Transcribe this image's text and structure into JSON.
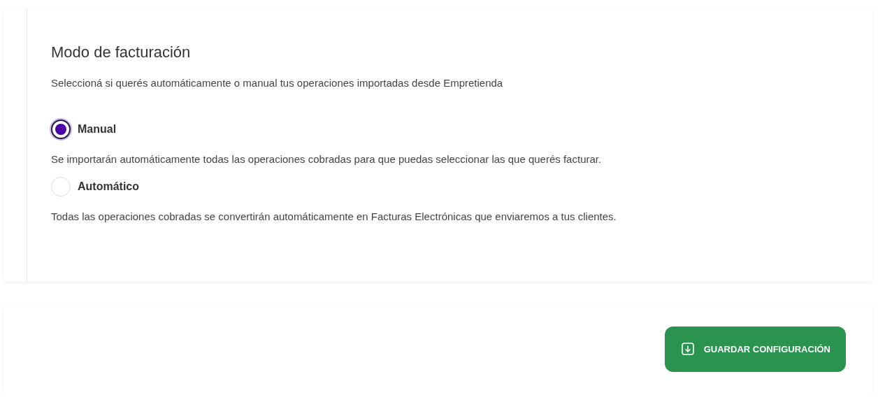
{
  "section": {
    "title": "Modo de facturación",
    "description": "Seleccioná si querés automáticamente o manual tus operaciones importadas desde Empretienda"
  },
  "options": [
    {
      "label": "Manual",
      "selected": true,
      "description": "Se importarán automáticamente todas las operaciones cobradas para que puedas seleccionar las que querés facturar."
    },
    {
      "label": "Automático",
      "selected": false,
      "description": "Todas las operaciones cobradas se convertirán automáticamente en Facturas Electrónicas que enviaremos a tus clientes."
    }
  ],
  "save_button": {
    "label": "GUARDAR CONFIGURACIÓN"
  }
}
